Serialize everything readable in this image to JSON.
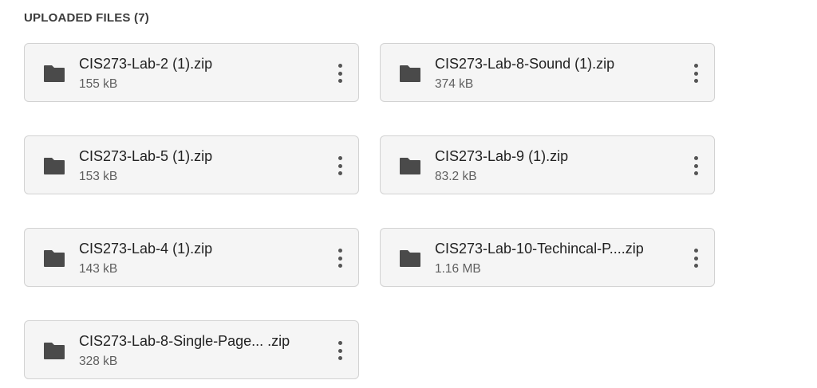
{
  "header": {
    "title": "UPLOADED FILES (7)"
  },
  "files": [
    {
      "name": "CIS273-Lab-2 (1).zip",
      "size": "155 kB"
    },
    {
      "name": "CIS273-Lab-8-Sound (1).zip",
      "size": "374 kB"
    },
    {
      "name": "CIS273-Lab-5 (1).zip",
      "size": "153 kB"
    },
    {
      "name": "CIS273-Lab-9 (1).zip",
      "size": "83.2 kB"
    },
    {
      "name": "CIS273-Lab-4 (1).zip",
      "size": "143 kB"
    },
    {
      "name": "CIS273-Lab-10-Techincal-P....zip",
      "size": "1.16 MB"
    },
    {
      "name": "CIS273-Lab-8-Single-Page... .zip",
      "size": "328 kB"
    }
  ],
  "icons": {
    "file": "folder-icon",
    "menu": "more-vert-icon"
  },
  "colors": {
    "card_bg": "#f5f5f5",
    "card_border": "#d2d2d2",
    "icon": "#4a4a4a"
  }
}
